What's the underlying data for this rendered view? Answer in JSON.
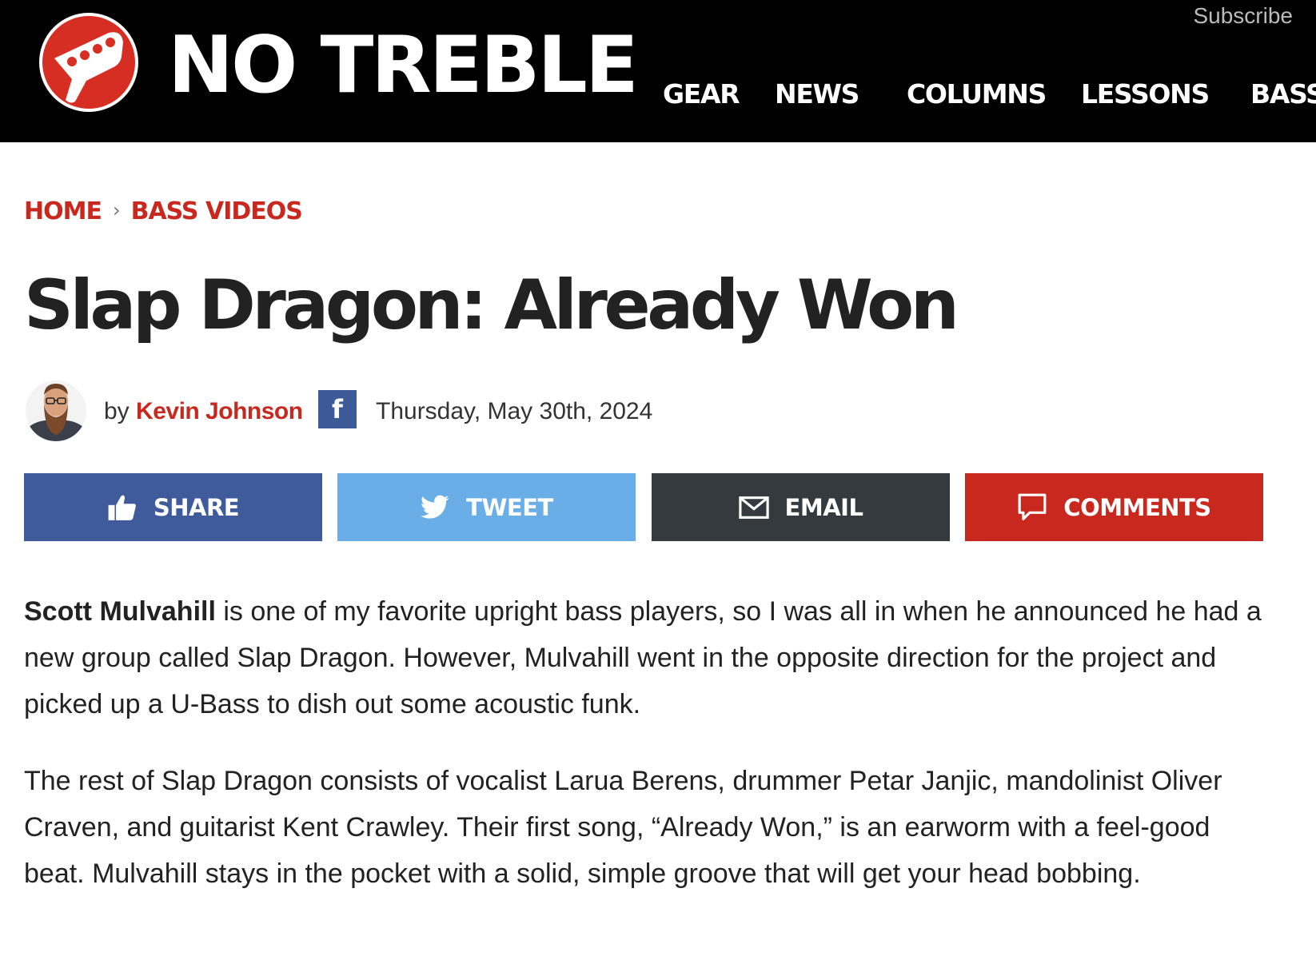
{
  "header": {
    "logo_text": "NO TREBLE",
    "subscribe": "Subscribe",
    "nav": [
      "GEAR",
      "NEWS",
      "COLUMNS",
      "LESSONS",
      "BASS"
    ]
  },
  "breadcrumb": {
    "home": "HOME",
    "separator": "›",
    "section": "BASS VIDEOS"
  },
  "article": {
    "title": "Slap Dragon: Already Won",
    "byline_prefix": "by",
    "author": "Kevin Johnson",
    "date": "Thursday, May 30th, 2024",
    "facebook_glyph": "f"
  },
  "share_buttons": {
    "share": "SHARE",
    "tweet": "TWEET",
    "email": "EMAIL",
    "comments": "COMMENTS"
  },
  "body": {
    "p1_bold": "Scott Mulvahill",
    "p1_rest": " is one of my favorite upright bass players, so I was all in when he announced he had a new group called Slap Dragon. However, Mulvahill went in the opposite direction for the project and picked up a U-Bass to dish out some acoustic funk.",
    "p2": "The rest of Slap Dragon consists of vocalist Larua Berens, drummer Petar Janjic, mandolinist Oliver Craven, and guitarist Kent Crawley. Their first song, “Already Won,” is an earworm with a feel-good beat. Mulvahill stays in the pocket with a solid, simple groove that will get your head bobbing."
  },
  "colors": {
    "brand_red": "#c8281e",
    "header_bg": "#000000",
    "share_blue": "#3f5b9b",
    "tweet_blue": "#6aaee7",
    "email_dark": "#353a3f"
  },
  "icons": [
    "bass-headstock-logo-icon",
    "facebook-icon",
    "thumbs-up-icon",
    "twitter-bird-icon",
    "envelope-icon",
    "speech-bubble-icon"
  ]
}
